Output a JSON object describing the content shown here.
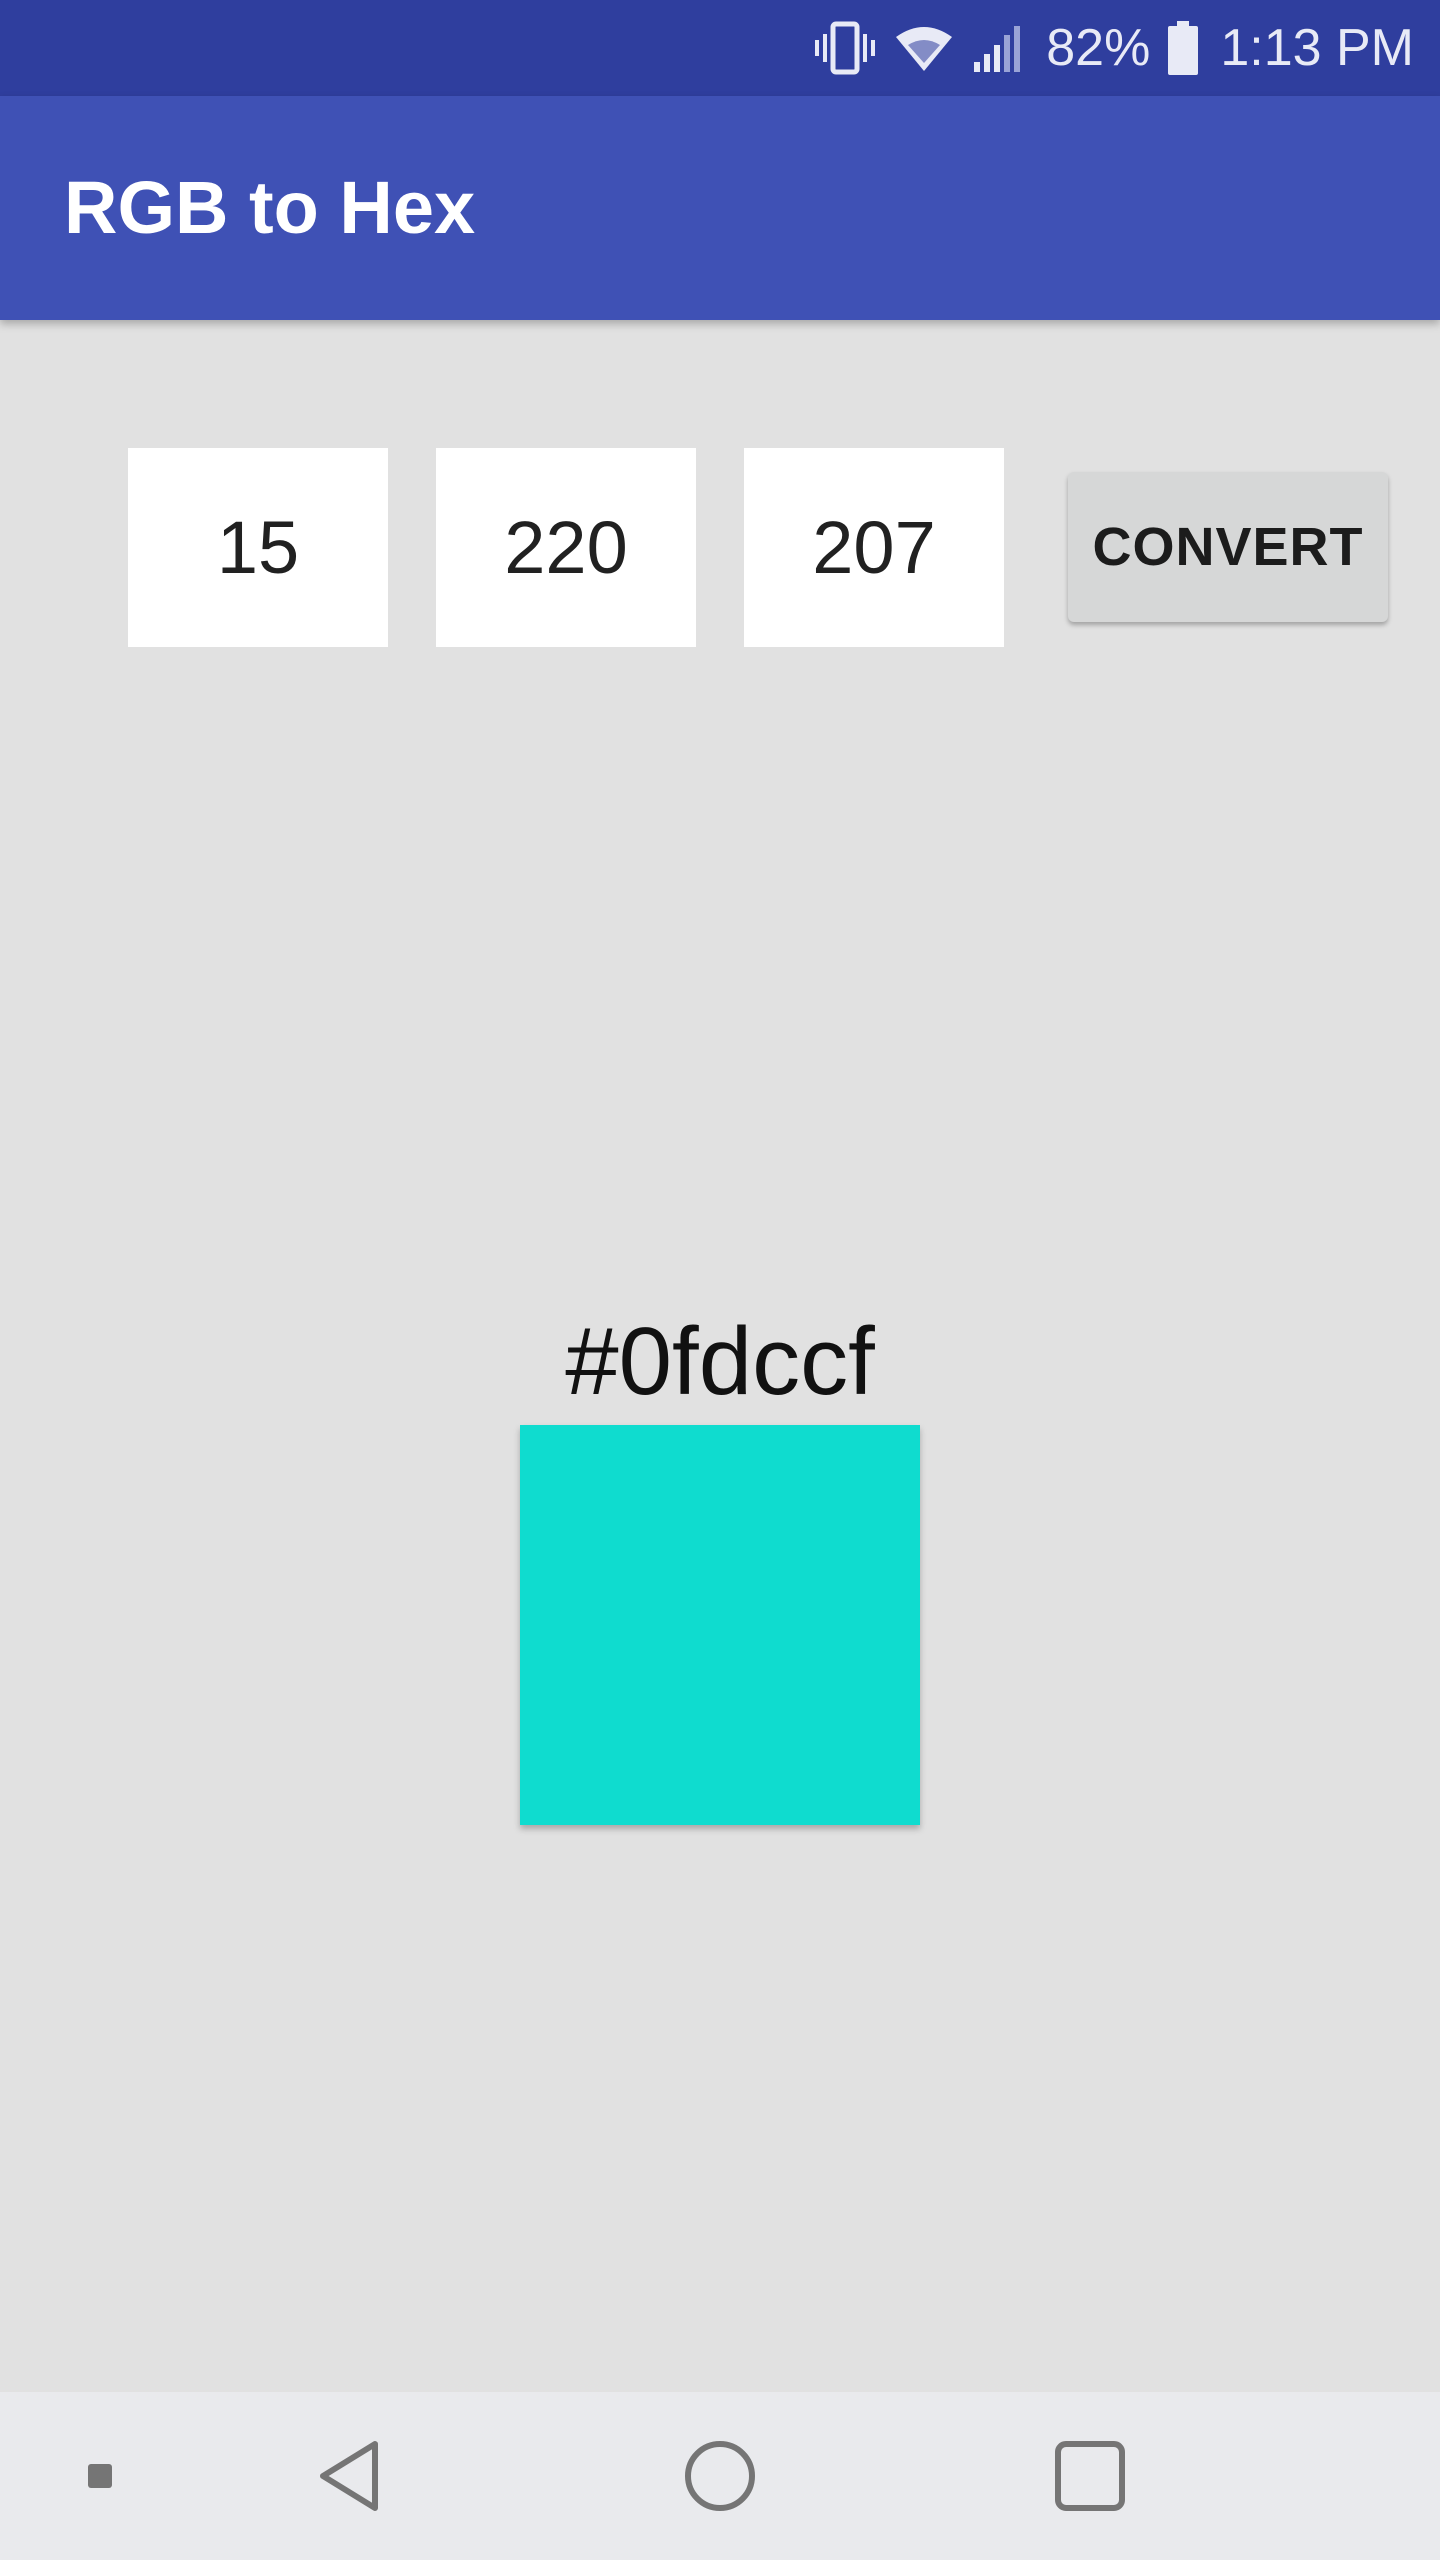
{
  "status_bar": {
    "battery_percent": "82%",
    "time": "1:13 PM"
  },
  "app_bar": {
    "title": "RGB to Hex"
  },
  "inputs": {
    "red": "15",
    "green": "220",
    "blue": "207"
  },
  "convert_button": {
    "label": "CONVERT"
  },
  "result": {
    "hex": "#0fdccf",
    "swatch_color": "#0fdccf"
  },
  "colors": {
    "status_bar": "#2f3e9e",
    "app_bar": "#3f51b5",
    "background": "#e1e1e1",
    "nav_bar": "#e9eaed"
  },
  "nav_bar": {
    "icons": [
      "dot-icon",
      "back-icon",
      "home-icon",
      "recents-icon"
    ]
  }
}
